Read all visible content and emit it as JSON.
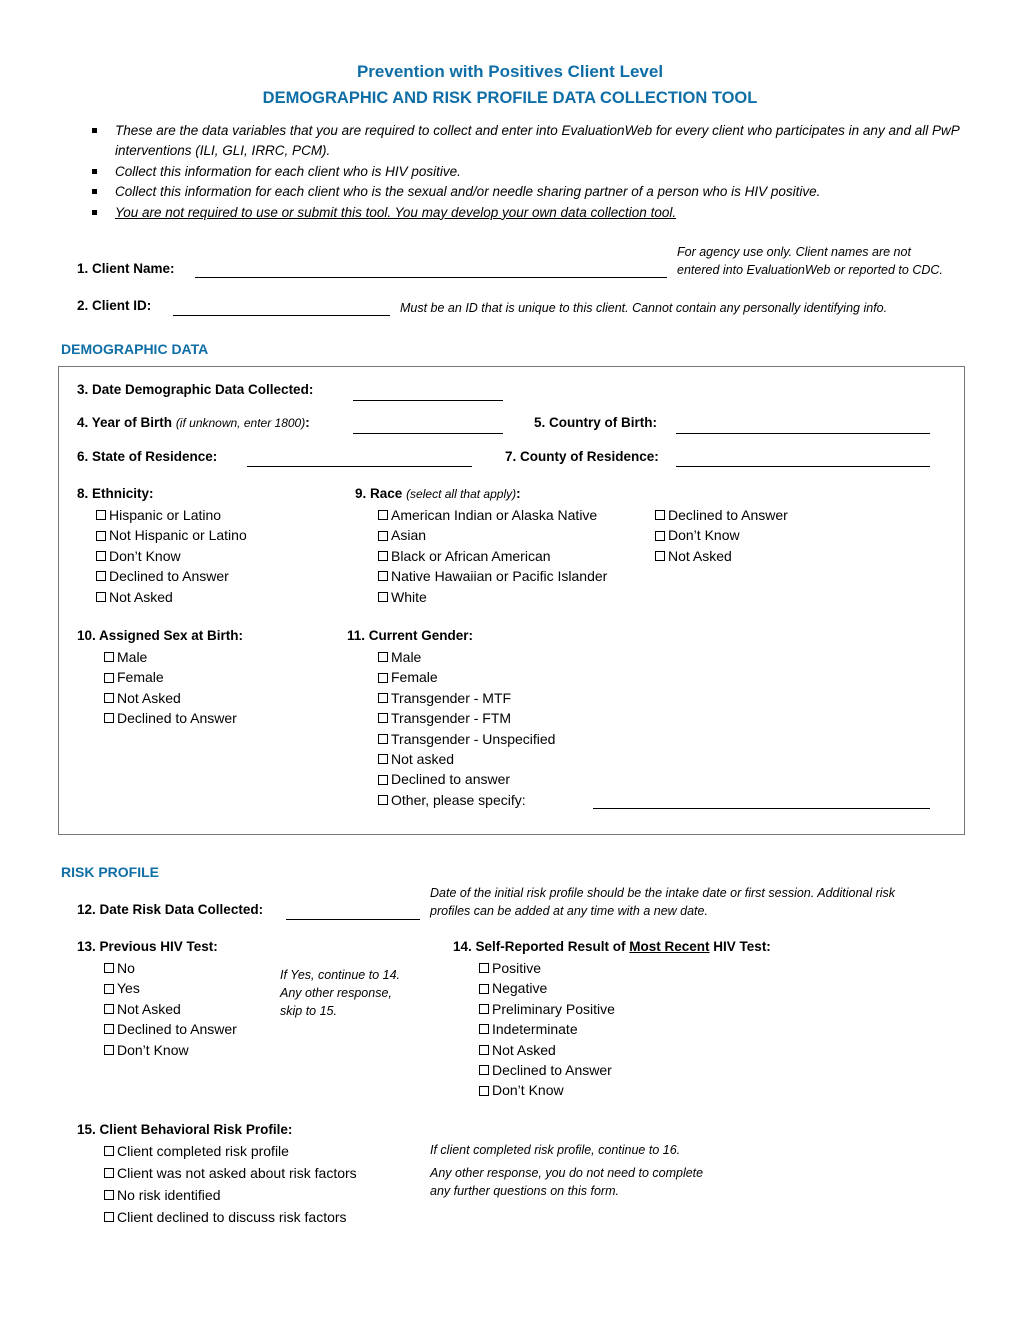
{
  "header": {
    "title_line1": "Prevention with Positives Client Level",
    "title_line2": "DEMOGRAPHIC AND RISK PROFILE DATA COLLECTION TOOL"
  },
  "bullets": [
    {
      "text": "These are the data variables that you are required to collect and enter into EvaluationWeb for every client who participates in any and all PwP interventions (ILI, GLI, IRRC, PCM)."
    },
    {
      "text": "Collect this information for each client who is HIV positive."
    },
    {
      "text": "Collect this information for each client who is the sexual and/or needle sharing partner of a person who is HIV positive."
    },
    {
      "text": "You are not required to use or submit this tool. You may develop your own data collection tool."
    }
  ],
  "client": {
    "name_label": "1. Client Name:",
    "name_value": "",
    "name_note_line1": "For agency use only. Client names are not",
    "name_note_line2": "entered into EvaluationWeb or reported to CDC.",
    "id_label": "2. Client ID:",
    "id_value": "",
    "id_note": "Must be an ID that is unique to this client. Cannot contain any personally identifying info."
  },
  "demographic": {
    "section_title": "DEMOGRAPHIC DATA",
    "q3_label": "3. Date Demographic Data Collected:",
    "q3_value": "",
    "q4_label": "4. Year of Birth",
    "q4_hint": "(if unknown, enter 1800)",
    "q4_colon": ":",
    "q4_value": "",
    "q5_label": "5. Country of Birth:",
    "q5_value": "",
    "q6_label": "6. State of Residence:",
    "q6_value": "",
    "q7_label": "7. County of Residence:",
    "q7_value": "",
    "q8": {
      "label": "8. Ethnicity:",
      "options": [
        "Hispanic or Latino",
        "Not Hispanic or Latino",
        "Don’t Know",
        "Declined to Answer",
        "Not Asked"
      ]
    },
    "q9": {
      "label": "9. Race",
      "hint": "(select all that apply)",
      "colon": ":",
      "options_col1": [
        "American Indian or Alaska Native",
        "Asian",
        "Black or African American",
        "Native Hawaiian or Pacific Islander",
        "White"
      ],
      "options_col2": [
        "Declined to Answer",
        "Don’t Know",
        "Not Asked"
      ]
    },
    "q10": {
      "label": "10. Assigned Sex at Birth:",
      "options": [
        "Male",
        "Female",
        "Not Asked",
        "Declined to Answer"
      ]
    },
    "q11": {
      "label": "11. Current Gender:",
      "options": [
        "Male",
        "Female",
        "Transgender - MTF",
        "Transgender - FTM",
        "Transgender - Unspecified",
        "Not asked",
        "Declined to answer",
        "Other, please specify:"
      ],
      "other_value": ""
    }
  },
  "risk": {
    "section_title": "RISK PROFILE",
    "q12_label": "12. Date Risk Data Collected:",
    "q12_value": "",
    "q12_note_line1": "Date of the initial risk profile should be the intake date or first session. Additional risk",
    "q12_note_line2": "profiles can be added at any time with a new date.",
    "q13": {
      "label": "13. Previous HIV Test:",
      "options": [
        "No",
        "Yes",
        "Not Asked",
        "Declined to Answer",
        "Don’t Know"
      ],
      "note_lines": [
        "If Yes, continue to 14.",
        "Any other response,",
        "skip to 15."
      ]
    },
    "q14": {
      "label_pre": "14. Self-Reported Result of ",
      "label_underlined": "Most Recent",
      "label_post": " HIV Test:",
      "options": [
        "Positive",
        "Negative",
        "Preliminary Positive",
        "Indeterminate",
        "Not Asked",
        "Declined to Answer",
        "Don’t Know"
      ]
    },
    "q15": {
      "label": "15. Client Behavioral Risk Profile:",
      "options": [
        "Client completed risk profile",
        "Client was not asked about risk factors",
        "No risk identified",
        "Client declined to discuss risk factors"
      ],
      "note_line1": "If client completed risk profile, continue to 16.",
      "note_line2": "Any other response, you do not need to complete",
      "note_line3": "any further questions on this form."
    }
  }
}
